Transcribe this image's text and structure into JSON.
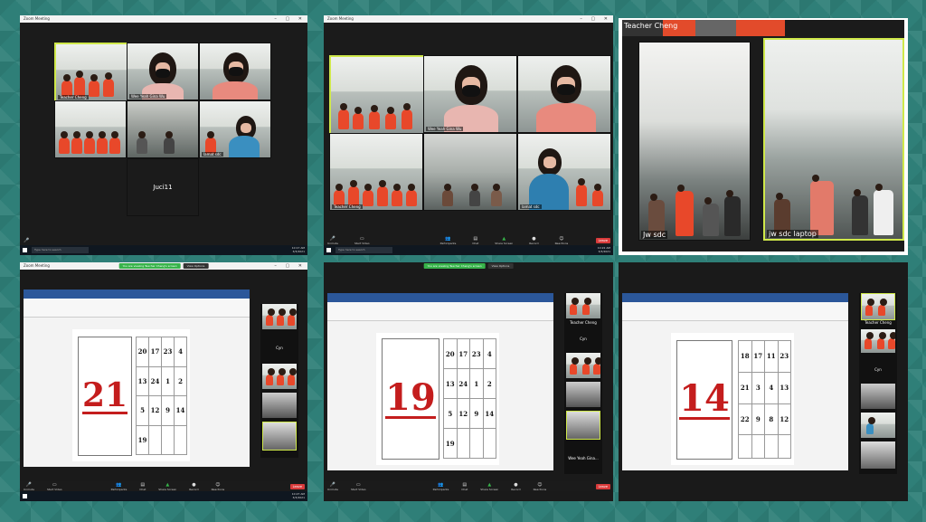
{
  "panel1": {
    "window_title": "Zoom Meeting",
    "tiles": [
      "Teacher Cheng",
      "Wee Yeah Gina Wu",
      "",
      "",
      "",
      "lamat sdc",
      "Juci11"
    ],
    "toolbar": [
      "Unmute",
      "Start Video"
    ],
    "search": "Type here to search",
    "tray": "10:17 AM\n3/3/2021"
  },
  "panel2": {
    "window_title": "Zoom Meeting",
    "tiles": [
      "",
      "Wee Yeah Gina Wu",
      "",
      "Teacher Cheng",
      "",
      "lamat sdc",
      "jw sdc laptop"
    ],
    "toolbar": [
      "Unmute",
      "Start Video",
      "Participants",
      "Chat",
      "Share Screen",
      "Record",
      "Reactions"
    ],
    "end": "Leave",
    "search": "Type here to search",
    "tray": "10:22 AM\n3/3/2021"
  },
  "panel3": {
    "top_label": "Teacher Cheng",
    "left_label": "Jw sdc",
    "right_label": "jw sdc laptop"
  },
  "panel4": {
    "window_title": "Zoom Meeting",
    "banner": "You are viewing Teacher Cheng's screen",
    "options": "View Options",
    "number": "21",
    "grid": [
      "20",
      "17",
      "23",
      "4",
      "13",
      "24",
      "1",
      "2",
      "5",
      "12",
      "9",
      "14",
      "19",
      "",
      "",
      ""
    ],
    "side_label": "Cyn",
    "toolbar": [
      "Unmute",
      "Start Video",
      "Participants",
      "Chat",
      "Share Screen",
      "Record",
      "Reactions"
    ],
    "end": "Leave",
    "tray": "10:27 AM\n3/3/2021"
  },
  "panel5": {
    "banner": "You are viewing Teacher Cheng's screen",
    "options": "View Options",
    "number": "19",
    "grid": [
      "20",
      "17",
      "23",
      "4",
      "13",
      "24",
      "1",
      "2",
      "5",
      "12",
      "9",
      "14",
      "19",
      "",
      "",
      ""
    ],
    "side_labels": [
      "Teacher Cheng",
      "Cyn",
      "Wee Yeah Gina..."
    ],
    "toolbar": [
      "Unmute",
      "Start Video",
      "Participants",
      "Chat",
      "Share Screen",
      "Record",
      "Reactions"
    ],
    "end": "Leave"
  },
  "panel6": {
    "number": "14",
    "grid": [
      "18",
      "17",
      "11",
      "23",
      "21",
      "3",
      "4",
      "13",
      "22",
      "9",
      "8",
      "12",
      "",
      "",
      "",
      ""
    ],
    "side_labels": [
      "Teacher Cheng",
      "Cyn"
    ]
  },
  "colors": {
    "accent": "#cfe84a",
    "number_red": "#c41d1d",
    "leave_red": "#d93b3b",
    "share_green": "#37b34a"
  }
}
